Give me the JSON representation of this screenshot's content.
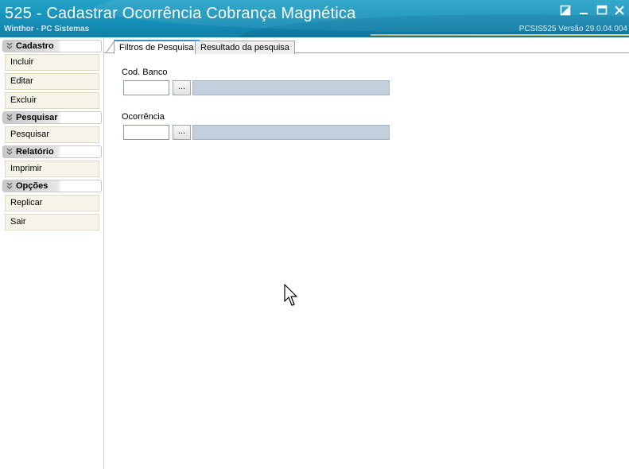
{
  "window": {
    "title": "525 - Cadastrar Ocorrência Cobrança Magnética",
    "subtitle": "Winthor - PC Sistemas",
    "version": "PCSIS525  Versão  29.0.04.004",
    "controls": [
      "restore-icon",
      "minimize-icon",
      "maximize-icon",
      "close-icon"
    ]
  },
  "sidebar": {
    "sections": [
      {
        "title": "Cadastro",
        "items": [
          "Incluir",
          "Editar",
          "Excluir"
        ]
      },
      {
        "title": "Pesquisar",
        "items": [
          "Pesquisar"
        ]
      },
      {
        "title": "Relatório",
        "items": [
          "Imprimir"
        ]
      },
      {
        "title": "Opções",
        "items": [
          "Replicar",
          "Sair"
        ]
      }
    ]
  },
  "tabs": [
    {
      "label": "Filtros de Pesquisa",
      "active": true
    },
    {
      "label": "Resultado da pesquisa",
      "active": false
    }
  ],
  "filters": {
    "cod_banco": {
      "label": "Cod. Banco",
      "value": "",
      "button": "...",
      "description": ""
    },
    "ocorrencia": {
      "label": "Ocorrência",
      "value": "",
      "button": "...",
      "description": ""
    }
  },
  "colors": {
    "titlebar": "#1591b9",
    "sidebar_button": "#f6f4e8",
    "description_field": "#c3d0dd",
    "active_tab_accent": "#3a8fd0"
  }
}
